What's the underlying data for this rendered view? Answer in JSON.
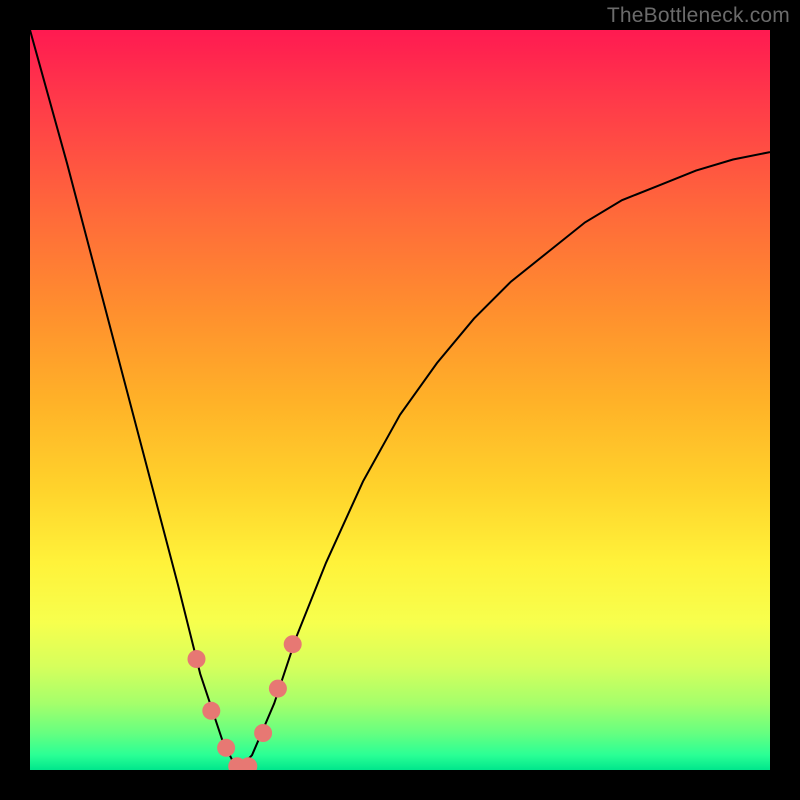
{
  "watermark": "TheBottleneck.com",
  "colors": {
    "gradient_top": "#ff1a51",
    "gradient_mid": "#ffd32b",
    "gradient_bottom": "#00e68c",
    "curve": "#000000",
    "markers": "#e77873",
    "frame": "#000000"
  },
  "chart_data": {
    "type": "line",
    "title": "",
    "xlabel": "",
    "ylabel": "",
    "xlim": [
      0,
      100
    ],
    "ylim": [
      0,
      100
    ],
    "description": "V-shaped bottleneck curve; low y = green (good), high y = red (bad). Minimum (~0) occurs near x ≈ 28.",
    "series": [
      {
        "name": "bottleneck-curve",
        "x": [
          0,
          5,
          10,
          15,
          20,
          23,
          26,
          28,
          30,
          33,
          36,
          40,
          45,
          50,
          55,
          60,
          65,
          70,
          75,
          80,
          85,
          90,
          95,
          100
        ],
        "y": [
          100,
          82,
          63,
          44,
          25,
          13,
          4,
          0,
          2,
          9,
          18,
          28,
          39,
          48,
          55,
          61,
          66,
          70,
          74,
          77,
          79,
          81,
          82.5,
          83.5
        ]
      }
    ],
    "markers": {
      "name": "highlight-dots",
      "x": [
        22.5,
        24.5,
        26.5,
        28,
        29.5,
        31.5,
        33.5,
        35.5
      ],
      "y": [
        15,
        8,
        3,
        0.5,
        0.5,
        5,
        11,
        17
      ]
    }
  }
}
